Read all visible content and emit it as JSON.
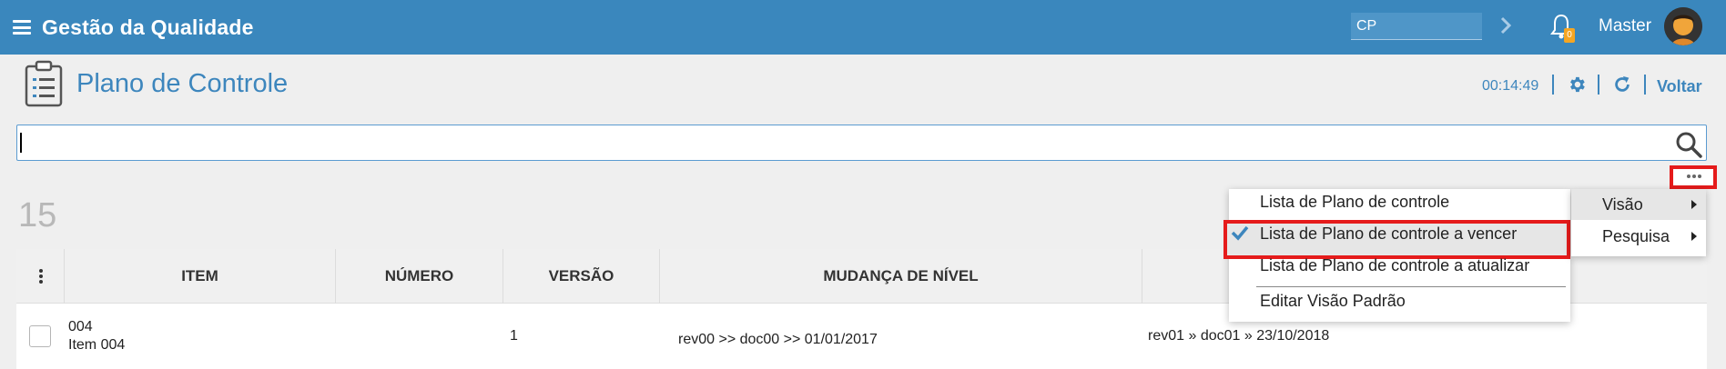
{
  "app": {
    "title": "Gestão da Qualidade"
  },
  "topbar": {
    "input_value": "CP",
    "badge_count": "0",
    "user_name": "Master"
  },
  "header": {
    "title": "Plano de Controle",
    "timer": "00:14:49",
    "back_label": "Voltar"
  },
  "search": {
    "value": "",
    "placeholder": ""
  },
  "result_count": "15",
  "table": {
    "columns": [
      "ITEM",
      "NÚMERO",
      "VERSÃO",
      "MUDANÇA DE NÍVEL"
    ],
    "rows": [
      {
        "item_code": "004",
        "item_name": "Item 004",
        "numero": "",
        "versao": "1",
        "mudanca_nivel": "rev00 >> doc00 >> 01/01/2017",
        "extra": "rev01 » doc01 » 23/10/2018"
      }
    ]
  },
  "menu": {
    "items": [
      {
        "label": "Lista de Plano de controle",
        "checked": false
      },
      {
        "label": "Lista de Plano de controle a vencer",
        "checked": true
      },
      {
        "label": "Lista de Plano de controle a atualizar",
        "checked": false
      },
      {
        "label": "Editar Visão Padrão",
        "checked": false
      }
    ],
    "side_items": [
      {
        "label": "Visão"
      },
      {
        "label": "Pesquisa"
      }
    ]
  },
  "colors": {
    "accent": "#3a87bd",
    "highlight_border": "#e51b1b",
    "badge": "#f5a623"
  },
  "icons": [
    "menu-icon",
    "chevron-right-icon",
    "bell-icon",
    "avatar",
    "clipboard-icon",
    "gear-icon",
    "refresh-icon",
    "search-icon",
    "more-dots-icon",
    "kebab-icon",
    "check-icon"
  ]
}
